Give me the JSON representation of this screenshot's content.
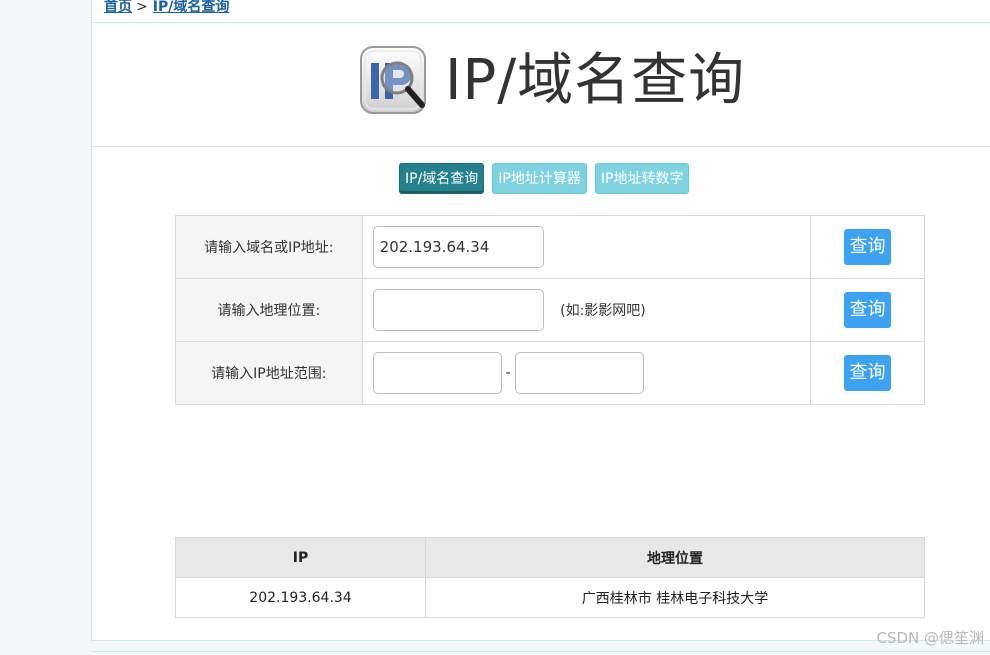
{
  "breadcrumb": {
    "home": "首页",
    "separator": ">",
    "current": "IP/域名查询"
  },
  "header": {
    "logo_icon": "ip-magnifier-icon",
    "title": "IP/域名查询"
  },
  "tabs": [
    {
      "label": "IP/域名查询",
      "active": true
    },
    {
      "label": "IP地址计算器",
      "active": false
    },
    {
      "label": "IP地址转数字",
      "active": false
    }
  ],
  "form": {
    "domain_row": {
      "label": "请输入域名或IP地址:",
      "value": "202.193.64.34",
      "button": "查询"
    },
    "location_row": {
      "label": "请输入地理位置:",
      "value": "",
      "hint": "(如:影影网吧)",
      "button": "查询"
    },
    "range_row": {
      "label": "请输入IP地址范围:",
      "start_value": "",
      "separator": "-",
      "end_value": "",
      "button": "查询"
    }
  },
  "results": {
    "headers": [
      "IP",
      "地理位置"
    ],
    "rows": [
      [
        "202.193.64.34",
        "广西桂林市 桂林电子科技大学"
      ]
    ]
  },
  "watermark": "CSDN @偲笙渊",
  "colors": {
    "tab_active": "#23808c",
    "tab_inactive": "#7fd3e0",
    "button": "#3ea2f3",
    "link": "#1a5fa0"
  }
}
